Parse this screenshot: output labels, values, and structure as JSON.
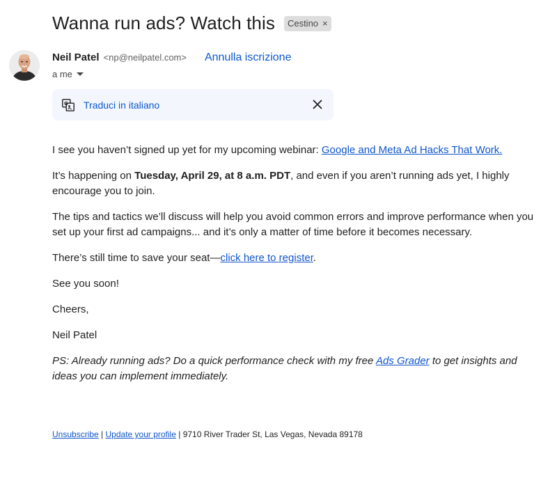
{
  "email": {
    "subject": "Wanna run ads? Watch this",
    "label_chip": "Cestino",
    "label_chip_close": "×",
    "sender_name": "Neil Patel",
    "sender_email": "<np@neilpatel.com>",
    "unsubscribe_link": "Annulla iscrizione",
    "recipient": "a me"
  },
  "translate": {
    "label": "Traduci in italiano"
  },
  "body": {
    "p1_text": "I see you haven’t signed up yet for my upcoming webinar: ",
    "p1_link": "Google and Meta Ad Hacks That Work.",
    "p2_pre": "It’s happening on ",
    "p2_bold": "Tuesday, April 29, at 8 a.m. PDT",
    "p2_post": ", and even if you aren’t running ads yet, I highly encourage you to join.",
    "p3": "The tips and tactics we’ll discuss will help you avoid common errors and improve performance when you set up your first ad campaigns... and it’s only a matter of time before it becomes necessary.",
    "p4_pre": "There’s still time to save your seat—",
    "p4_link": "click here to register",
    "p4_post": ".",
    "p5": "See you soon!",
    "p6": "Cheers,",
    "p7": "Neil Patel",
    "ps_pre": "PS: Already running ads? Do a quick performance check with my free ",
    "ps_link": "Ads Grader",
    "ps_post": " to get insights and ideas you can implement immediately."
  },
  "footer": {
    "unsubscribe": "Unsubscribe",
    "sep1": " | ",
    "update_profile": "Update your profile",
    "sep2": " | ",
    "address": "9710 River Trader St, Las Vegas, Nevada 89178"
  },
  "colors": {
    "link": "#1155cc",
    "accent": "#0b57d0",
    "translate_bg": "#f3f6fc",
    "chip_bg": "#dddddd"
  },
  "icons": {
    "translate": "translate-icon",
    "close": "close-icon",
    "caret": "caret-down-icon"
  }
}
